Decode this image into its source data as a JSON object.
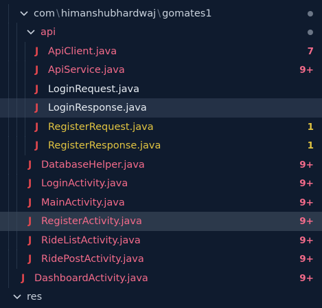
{
  "explorer": {
    "folders": {
      "package_path": {
        "seg1": "com",
        "seg2": "himanshubhardwaj",
        "seg3": "gomates1",
        "separator": "\\"
      },
      "api": "api",
      "res": "res"
    },
    "files": [
      {
        "name": "ApiClient.java",
        "badge": "7",
        "status": "error"
      },
      {
        "name": "ApiService.java",
        "badge": "9+",
        "status": "error"
      },
      {
        "name": "LoginRequest.java",
        "badge": "",
        "status": "clean"
      },
      {
        "name": "LoginResponse.java",
        "badge": "",
        "status": "clean"
      },
      {
        "name": "RegisterRequest.java",
        "badge": "1",
        "status": "warning"
      },
      {
        "name": "RegisterResponse.java",
        "badge": "1",
        "status": "warning"
      },
      {
        "name": "DatabaseHelper.java",
        "badge": "9+",
        "status": "error"
      },
      {
        "name": "LoginActivity.java",
        "badge": "9+",
        "status": "error"
      },
      {
        "name": "MainActivity.java",
        "badge": "9+",
        "status": "error"
      },
      {
        "name": "RegisterActivity.java",
        "badge": "9+",
        "status": "error"
      },
      {
        "name": "RideListActivity.java",
        "badge": "9+",
        "status": "error"
      },
      {
        "name": "RidePostActivity.java",
        "badge": "9+",
        "status": "error"
      },
      {
        "name": "DashboardActivity.java",
        "badge": "9+",
        "status": "error"
      }
    ],
    "java_icon_glyph": "J",
    "colors": {
      "background": "#0f1b2e",
      "selected_row": "#2c394b",
      "error": "#f36b8a",
      "warning": "#e0c341",
      "java_icon": "#e2474e"
    }
  }
}
